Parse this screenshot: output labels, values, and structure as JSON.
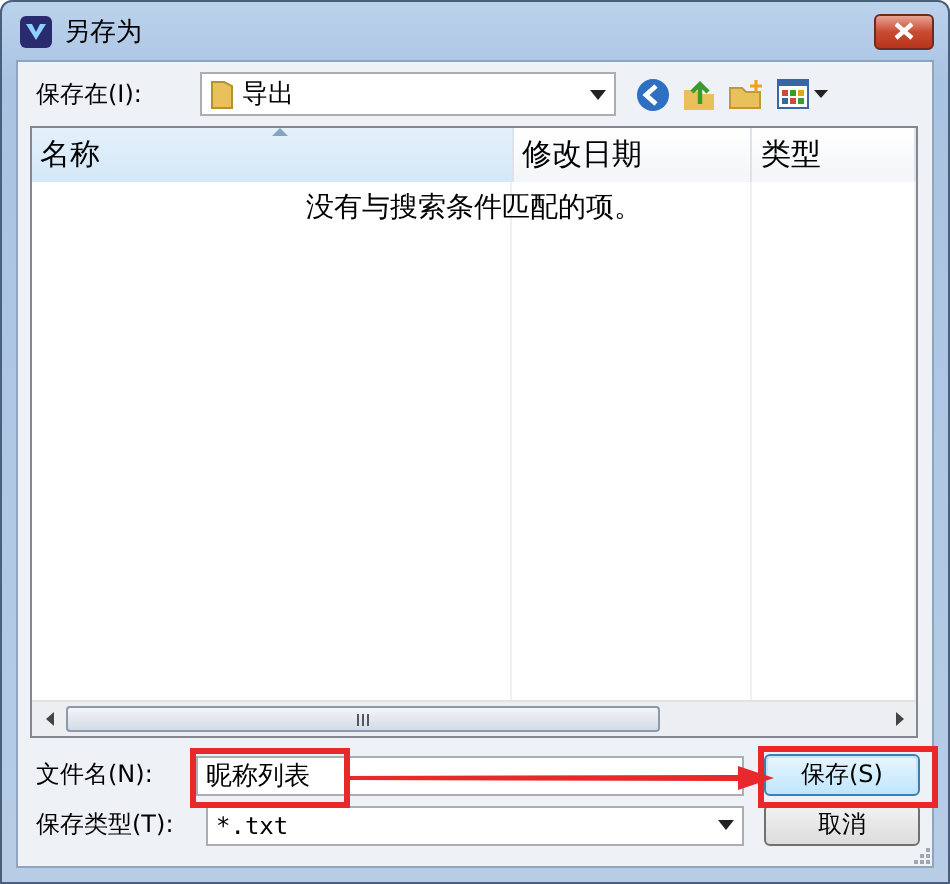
{
  "window": {
    "title": "另存为"
  },
  "location": {
    "label": "保存在(I):",
    "value": "导出"
  },
  "file_list": {
    "columns": [
      {
        "label": "名称",
        "sorted": true
      },
      {
        "label": "修改日期",
        "sorted": false
      },
      {
        "label": "类型",
        "sorted": false
      }
    ],
    "empty_message": "没有与搜索条件匹配的项。"
  },
  "file_name": {
    "label": "文件名(N):",
    "value": "昵称列表",
    "highlighted": true
  },
  "file_type": {
    "label": "保存类型(T):",
    "value": "*.txt"
  },
  "buttons": [
    {
      "label": "保存(S)",
      "kind": "primary",
      "highlighted": true
    },
    {
      "label": "取消",
      "kind": "cancel",
      "highlighted": false
    }
  ],
  "annotation_arrow": true
}
